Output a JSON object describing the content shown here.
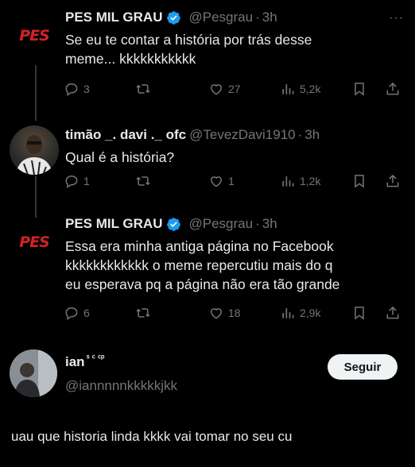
{
  "tweets": [
    {
      "name": "PES MIL GRAU",
      "handle": "@Pesgrau",
      "sep": "·",
      "time": "3h",
      "lines": [
        "Se eu te contar a história por trás desse",
        "meme... kkkkkkkkkkk"
      ],
      "stats": {
        "replies": "3",
        "likes": "27",
        "views": "5,2k"
      },
      "avatar_text": "PES"
    },
    {
      "name": "timão _. davi ._ ofc",
      "handle": "@TevezDavi1910",
      "sep": "·",
      "time": "3h",
      "lines": [
        "Qual é a história?"
      ],
      "stats": {
        "replies": "1",
        "likes": "1",
        "views": "1,2k"
      }
    },
    {
      "name": "PES MIL GRAU",
      "handle": "@Pesgrau",
      "sep": "·",
      "time": "3h",
      "lines": [
        "Essa era minha antiga página no Facebook",
        "kkkkkkkkkkkk o meme repercutiu mais do q",
        "eu esperava pq a página não era tão grande"
      ],
      "stats": {
        "replies": "6",
        "likes": "18",
        "views": "2,9k"
      },
      "avatar_text": "PES"
    }
  ],
  "profile": {
    "name": "ian",
    "name_suffix": "ˢ ᶜ ᶜᵖ",
    "handle": "@iannnnnkkkkkjkk",
    "follow_label": "Seguir"
  },
  "reply_text": "uau que historia linda kkkk vai tomar no seu cu",
  "more_label": "···",
  "colors": {
    "background": "#000000",
    "text": "#e7e9ea",
    "muted": "#71767b",
    "verified": "#1d9bf0",
    "brand_red": "#d42027"
  }
}
